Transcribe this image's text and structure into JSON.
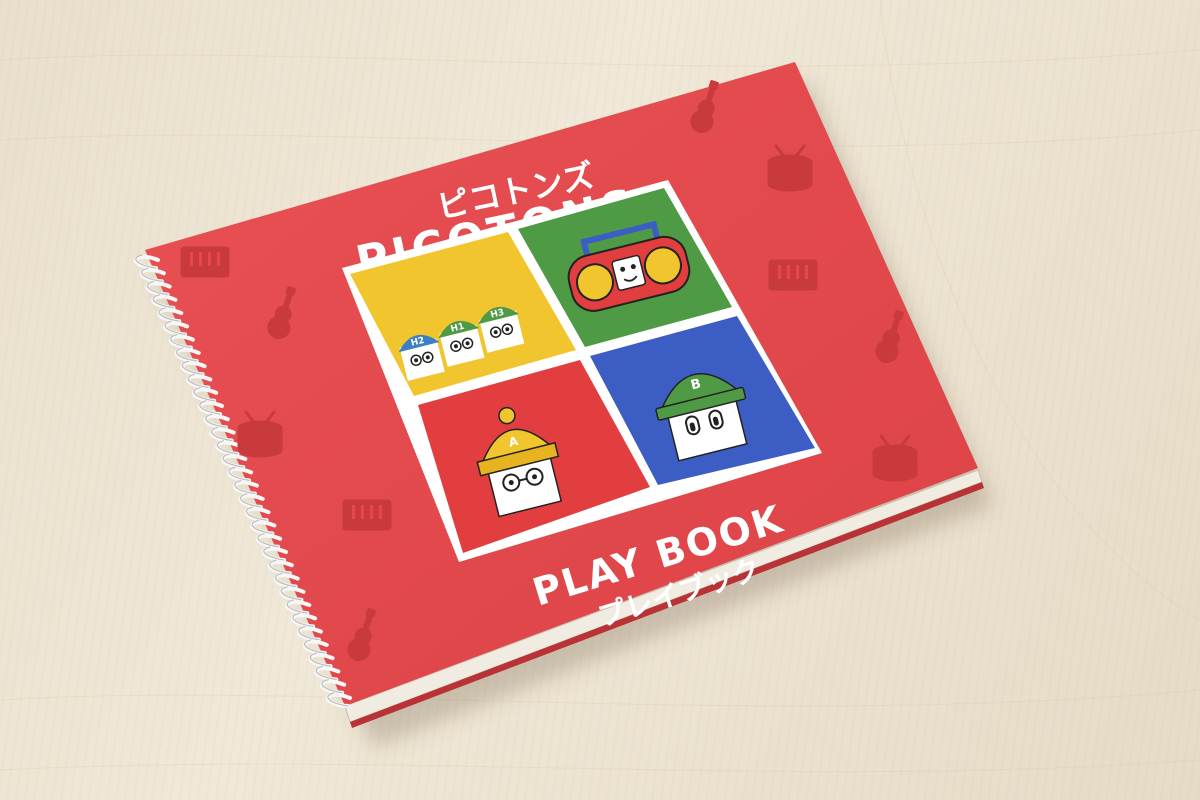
{
  "book": {
    "title_katakana": "ピコトンズ",
    "title_latin": "PICOTONS",
    "subtitle_latin": "PLAY BOOK",
    "subtitle_katakana": "プレイブック"
  },
  "characters": {
    "h2_label": "H2",
    "h1_label": "H1",
    "h3_label": "H3",
    "a_label": "A",
    "b_label": "B"
  },
  "colors": {
    "cover_red": "#e8464a",
    "panel_yellow": "#f0c52e",
    "panel_green": "#4f9a45",
    "panel_red": "#e23d3f",
    "panel_blue": "#3c5ec4",
    "icon_shade": "#c93a3c",
    "desk": "#ece3d1"
  },
  "icons": [
    "guitar-icon",
    "drum-icon",
    "piano-keys-icon",
    "boombox-icon"
  ]
}
